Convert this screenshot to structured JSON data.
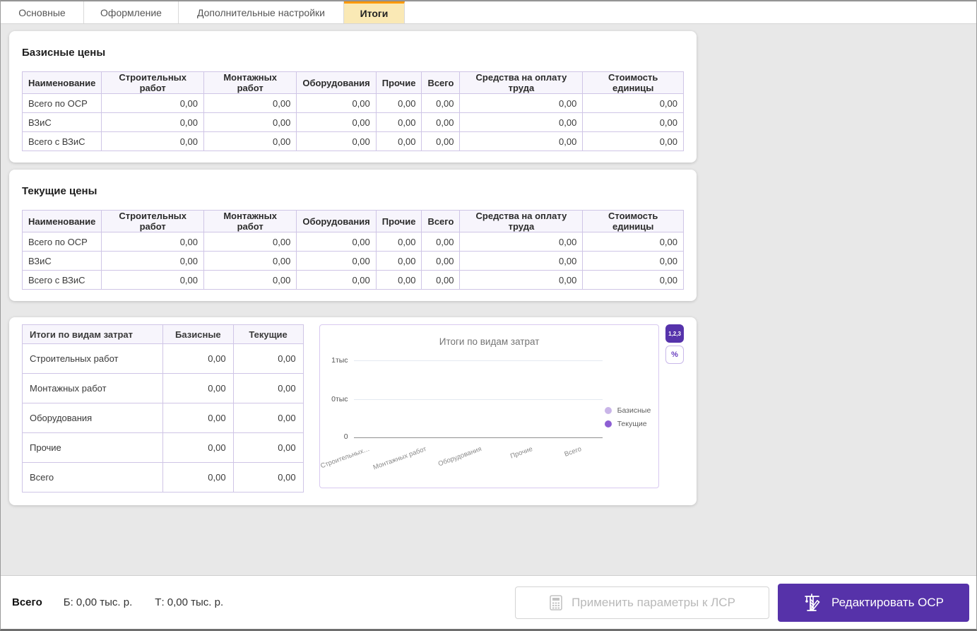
{
  "tabs": [
    {
      "label": "Основные",
      "active": false
    },
    {
      "label": "Оформление",
      "active": false
    },
    {
      "label": "Дополнительные настройки",
      "active": false
    },
    {
      "label": "Итоги",
      "active": true
    }
  ],
  "colors": {
    "accent_orange": "#ff9800",
    "active_tab_bg": "#fae9b5",
    "purple": "#5633ab",
    "table_border": "#cfc5e6",
    "header_bg": "#f7f5fc",
    "legend_base": "#c9b5e8",
    "legend_current": "#8d5fd3"
  },
  "price_columns": [
    "Наименование",
    "Строительных работ",
    "Монтажных работ",
    "Оборудования",
    "Прочие",
    "Всего",
    "Средства на оплату труда",
    "Стоимость единицы"
  ],
  "base_prices": {
    "title": "Базисные цены",
    "rows": [
      {
        "name": "Всего по ОСР",
        "values": [
          "0,00",
          "0,00",
          "0,00",
          "0,00",
          "0,00",
          "0,00",
          "0,00"
        ]
      },
      {
        "name": "ВЗиС",
        "values": [
          "0,00",
          "0,00",
          "0,00",
          "0,00",
          "0,00",
          "0,00",
          "0,00"
        ]
      },
      {
        "name": "Всего с ВЗиС",
        "values": [
          "0,00",
          "0,00",
          "0,00",
          "0,00",
          "0,00",
          "0,00",
          "0,00"
        ]
      }
    ]
  },
  "current_prices": {
    "title": "Текущие цены",
    "rows": [
      {
        "name": "Всего по ОСР",
        "values": [
          "0,00",
          "0,00",
          "0,00",
          "0,00",
          "0,00",
          "0,00",
          "0,00"
        ]
      },
      {
        "name": "ВЗиС",
        "values": [
          "0,00",
          "0,00",
          "0,00",
          "0,00",
          "0,00",
          "0,00",
          "0,00"
        ]
      },
      {
        "name": "Всего с ВЗиС",
        "values": [
          "0,00",
          "0,00",
          "0,00",
          "0,00",
          "0,00",
          "0,00",
          "0,00"
        ]
      }
    ]
  },
  "totals_table": {
    "columns": [
      "Итоги по видам затрат",
      "Базисные",
      "Текущие"
    ],
    "rows": [
      {
        "name": "Строительных работ",
        "base": "0,00",
        "current": "0,00"
      },
      {
        "name": "Монтажных работ",
        "base": "0,00",
        "current": "0,00"
      },
      {
        "name": "Оборудования",
        "base": "0,00",
        "current": "0,00"
      },
      {
        "name": "Прочие",
        "base": "0,00",
        "current": "0,00"
      },
      {
        "name": "Всего",
        "base": "0,00",
        "current": "0,00"
      }
    ]
  },
  "chart_data": {
    "type": "bar",
    "title": "Итоги по видам затрат",
    "categories": [
      "Строительных работ",
      "Монтажных работ",
      "Оборудования",
      "Прочие",
      "Всего"
    ],
    "x_tick_labels": [
      "Строительных…",
      "Монтажных работ",
      "Оборудования",
      "Прочие",
      "Всего"
    ],
    "y_tick_labels": [
      "1тыс",
      "0тыс",
      "0"
    ],
    "ylim": [
      0,
      1000
    ],
    "grid": true,
    "legend_position": "right",
    "series": [
      {
        "name": "Базисные",
        "values": [
          0,
          0,
          0,
          0,
          0
        ],
        "color": "#c9b5e8"
      },
      {
        "name": "Текущие",
        "values": [
          0,
          0,
          0,
          0,
          0
        ],
        "color": "#8d5fd3"
      }
    ]
  },
  "chart_toggles": {
    "numbers": "1,2,3",
    "percent": "%"
  },
  "footer": {
    "total_label": "Всего",
    "base_total": "Б: 0,00 тыс. р.",
    "current_total": "Т: 0,00 тыс. р.",
    "apply_button": "Применить параметры к ЛСР",
    "edit_button": "Редактировать ОСР"
  }
}
